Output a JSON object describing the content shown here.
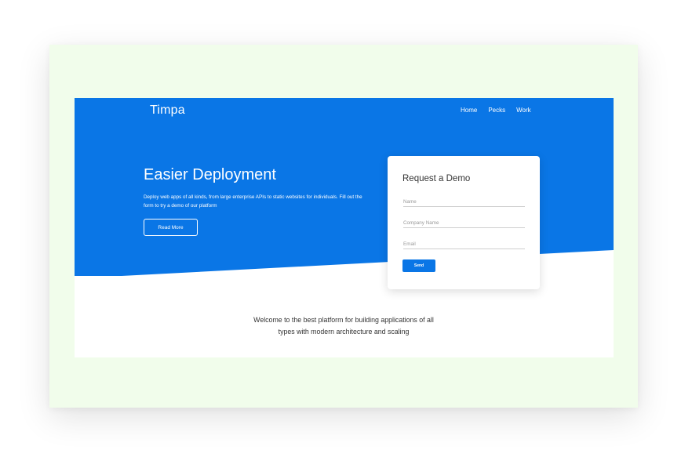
{
  "header": {
    "brand": "Timpa",
    "nav": [
      "Home",
      "Pecks",
      "Work"
    ]
  },
  "hero": {
    "title": "Easier Deployment",
    "description": "Deploy web apps of all kinds, from large enterprise APIs to static websites for individuals. Fill out the form to try a demo of our platform",
    "read_more_label": "Read More"
  },
  "demo_form": {
    "title": "Request a Demo",
    "name_placeholder": "Name",
    "company_placeholder": "Company Name",
    "email_placeholder": "Email",
    "send_label": "Send"
  },
  "welcome": {
    "text": "Welcome to the best platform for building applications of all types with modern architecture and scaling"
  },
  "colors": {
    "brand_blue": "#0a76e6",
    "frame_background": "#f1fdeb",
    "card_background": "#ffffff"
  }
}
